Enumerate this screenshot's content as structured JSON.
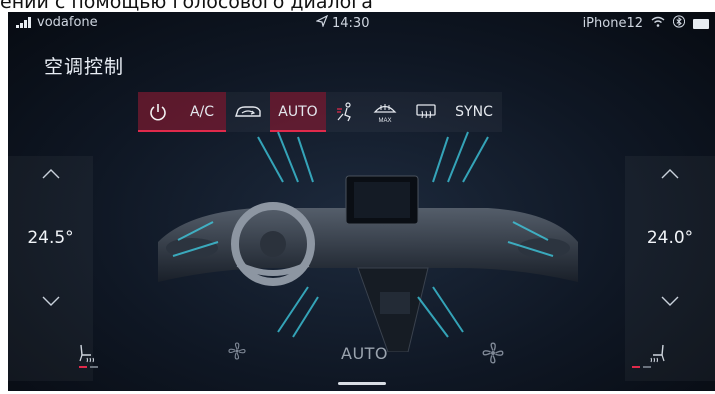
{
  "caption": "ении с помощью голосового диалога",
  "status_bar": {
    "carrier": "vodafone",
    "time": "14:30",
    "device": "iPhone12"
  },
  "page": {
    "title": "空调控制"
  },
  "control_bar": {
    "ac_label": "A/C",
    "auto_label": "AUTO",
    "sync_label": "SYNC",
    "max_label": "MAX",
    "active": [
      "power",
      "ac",
      "auto"
    ]
  },
  "left_zone": {
    "temperature": "24.5°",
    "seat_heat_level": 1
  },
  "right_zone": {
    "temperature": "24.0°",
    "seat_heat_level": 1
  },
  "fan": {
    "mode_label": "AUTO"
  },
  "colors": {
    "accent": "#e02a4b",
    "active_bg": "#7a1a2e",
    "airflow": "#3fd0e6",
    "text": "#e9eef5"
  }
}
